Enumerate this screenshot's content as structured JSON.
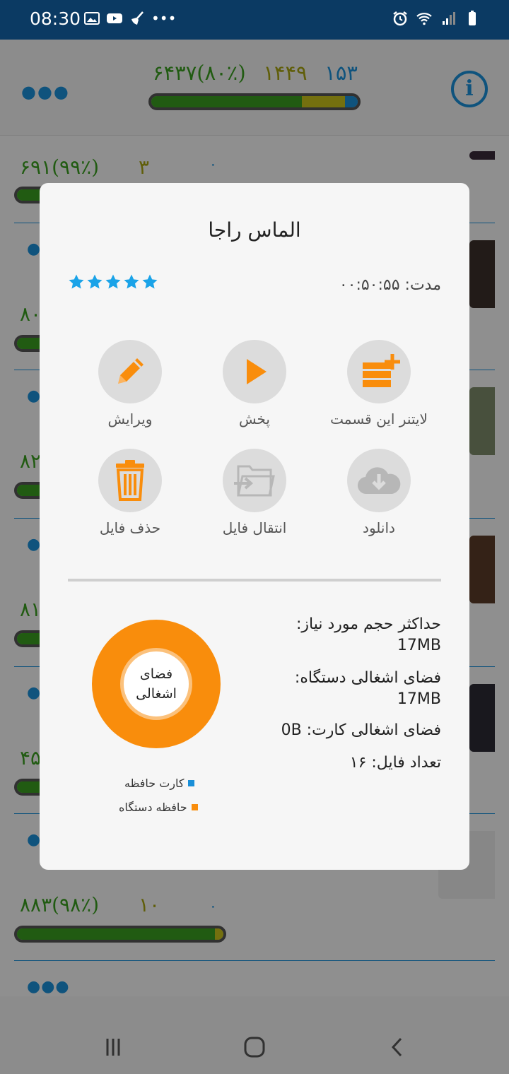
{
  "status_bar": {
    "time": "08:30",
    "more": "•••"
  },
  "header": {
    "stat_total": "۶۴۳۷(۸۰٪)",
    "stat_mid": "۱۴۴۹",
    "stat_right": "۱۵۳",
    "progress_green": 0.8,
    "progress_yellow": 0.18,
    "progress_blue": 0.02
  },
  "background_rows": [
    {
      "stat_a": "۶۹۱(۹۹٪)",
      "stat_b": "۳",
      "stat_c": "۰"
    },
    {
      "stat_a": "۸۰"
    },
    {
      "stat_a": "۸۲"
    },
    {
      "stat_a": "۸۱"
    },
    {
      "stat_a": "۴۵"
    },
    {
      "stat_a": "۸۸۳(۹۸٪)",
      "stat_b": "۱۰",
      "stat_c": "۰"
    }
  ],
  "dialog": {
    "title": "الماس راجا",
    "rating": 5,
    "duration_label": "مدت: ۰۰:۵۰:۵۵",
    "actions": {
      "edit": "ویرایش",
      "play": "پخش",
      "add_to_leitner": "لایتنر این قسمت",
      "delete_file": "حذف فایل",
      "move_file": "انتقال فایل",
      "download": "دانلود"
    },
    "info": {
      "max_size_label": "حداکثر حجم مورد نیاز:",
      "max_size_value": "17MB",
      "device_used_label": "فضای اشغالی دستگاه:",
      "device_used_value": "17MB",
      "card_used": "فضای اشغالی کارت: 0B",
      "file_count": "تعداد فایل: ۱۶"
    },
    "donut": {
      "center_line1": "فضای",
      "center_line2": "اشغالی",
      "legend_card": "کارت حافظه",
      "legend_device": "حافظه دستگاه",
      "card_color": "#1a8fd8",
      "device_color": "#f98d0c"
    }
  }
}
